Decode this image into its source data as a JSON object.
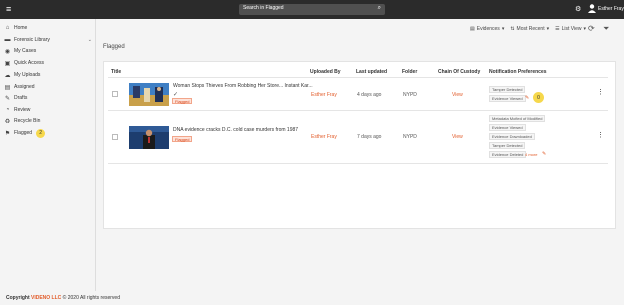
{
  "topbar": {
    "menu_glyph": "≡",
    "search_text": "Search in Flagged",
    "search_icon": "⌕",
    "settings_glyph": "⚙",
    "user_name": "Esther Fray"
  },
  "sidebar": {
    "items": [
      {
        "label": "Home",
        "icon": "⌂"
      },
      {
        "label": "Forensic Library",
        "icon": "▬",
        "chevron": "⌄"
      },
      {
        "label": "My Cases",
        "icon": "◉"
      },
      {
        "label": "Quick Access",
        "icon": "▣"
      },
      {
        "label": "My Uploads",
        "icon": "☁"
      },
      {
        "label": "Assigned",
        "icon": "▤"
      },
      {
        "label": "Drafts",
        "icon": "✎"
      },
      {
        "label": "Review",
        "icon": "◔"
      },
      {
        "label": "Recycle Bin",
        "icon": "♻"
      },
      {
        "label": "Flagged",
        "icon": "⚑",
        "count": "2"
      }
    ]
  },
  "page": {
    "title": "Flagged"
  },
  "toolbar": {
    "evidences": "Evidences",
    "sort": "Most Recent",
    "view": "List View",
    "refresh_glyph": "⟳",
    "filter_glyph": "⏷"
  },
  "table": {
    "headers": {
      "title": "Title",
      "uploaded_by": "Uploaded By",
      "last_updated": "Last updated",
      "folder": "Folder",
      "chain": "Chain Of Custody",
      "prefs": "Notification Preferences"
    },
    "rows": [
      {
        "title": "Woman Stops Thieves From Robbing Her Store... Instant Kar...",
        "tag": "Flagged",
        "uploaded_by": "Esther Fray",
        "last_updated": "4 days ago",
        "folder": "NYPD",
        "chain": "View",
        "prefs": [
          "Tamper Detected",
          "Evidence Viewed"
        ],
        "badge": "0"
      },
      {
        "title": "DNA evidence cracks D.C. cold case murders from 1987",
        "tag": "Flagged",
        "uploaded_by": "Esther Fray",
        "last_updated": "7 days ago",
        "folder": "NYPD",
        "chain": "View",
        "prefs": [
          "Metadata Mofied of Modified",
          "Evidence Viewed",
          "Evidence Downloaded",
          "Tamper Detected",
          "Evidence Deleted"
        ],
        "pref_extra": "4 more"
      }
    ]
  },
  "footer": {
    "prefix": "Copyright",
    "brand": "VIDENO LLC",
    "suffix": "© 2020 All rights reserved"
  },
  "colors": {
    "accent": "#e25c2a",
    "topbar": "#2b2b2b",
    "badge": "#f6d84c"
  }
}
